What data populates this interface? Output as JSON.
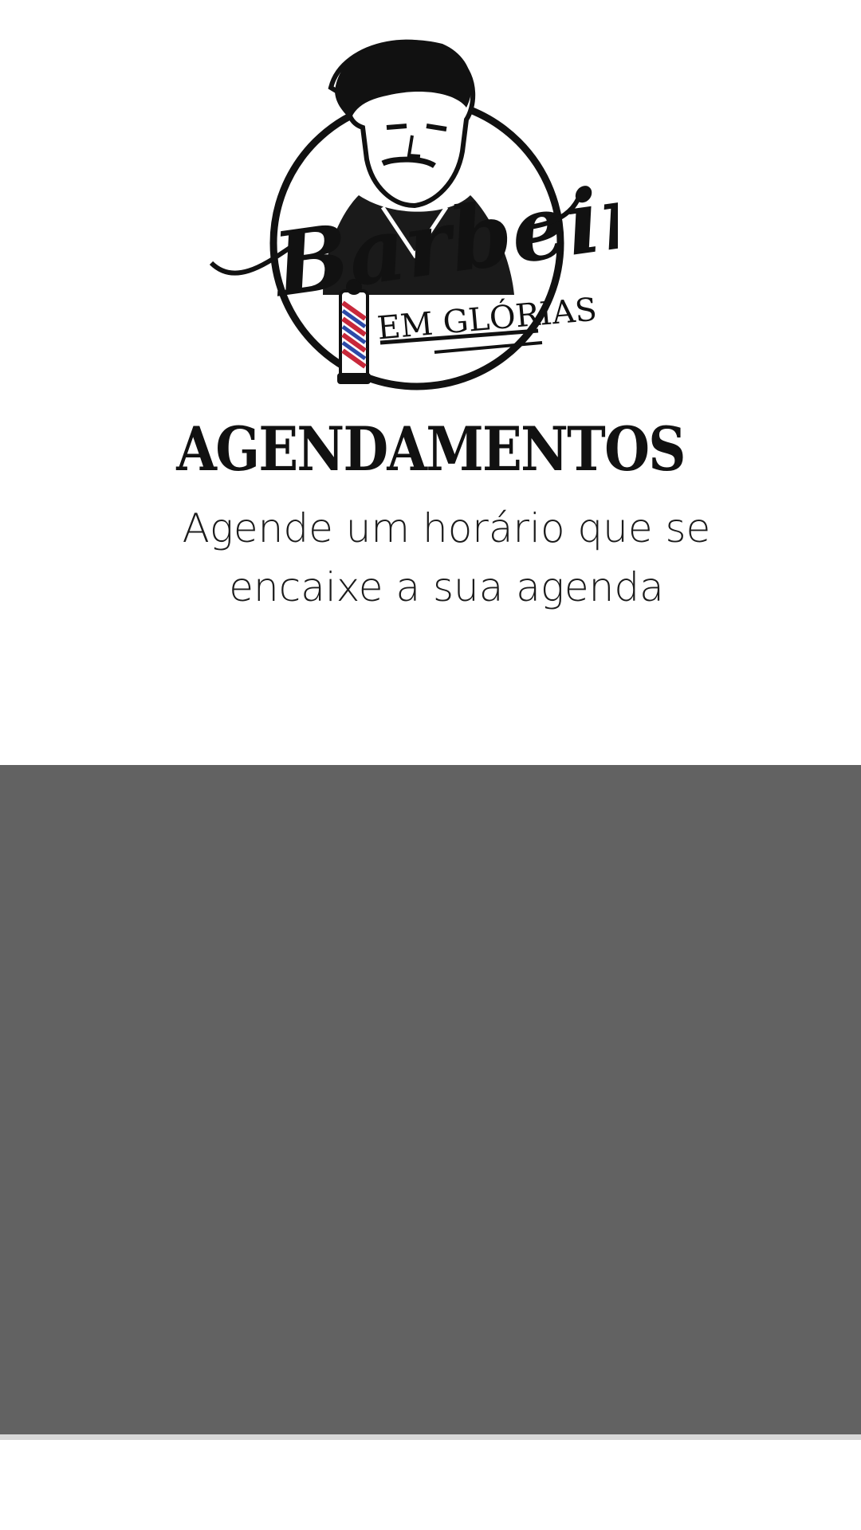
{
  "brand": {
    "logo_script_text": "Barbeiros",
    "logo_sub_text": "EM GLÓRIAS"
  },
  "header": {
    "title": "AGENDAMENTOS",
    "subtitle": "Agende um horário que se encaixe a sua agenda"
  },
  "colors": {
    "panel": "#626262",
    "divider": "#d8d8d8",
    "pole_red": "#c8283a",
    "pole_blue": "#2c4aa8"
  },
  "icons": {
    "logo": "barber-portrait-logo-icon",
    "pole": "barber-pole-icon"
  }
}
